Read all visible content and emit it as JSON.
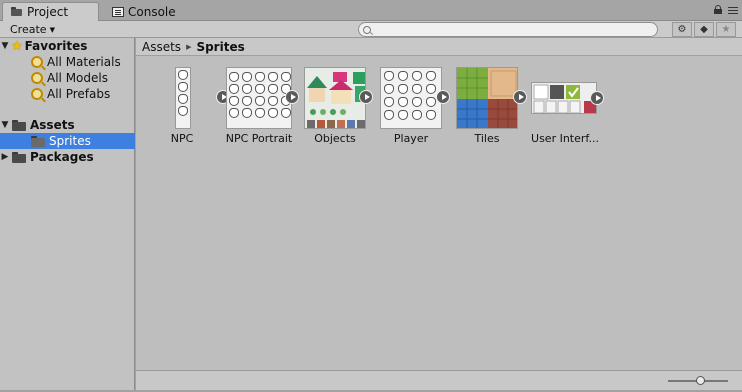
{
  "tabs": [
    {
      "label": "Project",
      "icon": "folder-icon"
    },
    {
      "label": "Console",
      "icon": "console-icon"
    }
  ],
  "toolbar": {
    "create_label": "Create",
    "search_placeholder": ""
  },
  "tree": {
    "favorites": {
      "label": "Favorites",
      "items": [
        "All Materials",
        "All Models",
        "All Prefabs"
      ]
    },
    "assets": {
      "label": "Assets",
      "children": [
        "Sprites"
      ]
    },
    "packages": {
      "label": "Packages"
    }
  },
  "breadcrumb": {
    "root": "Assets",
    "current": "Sprites"
  },
  "assets": [
    {
      "label": "NPC"
    },
    {
      "label": "NPC Portrait"
    },
    {
      "label": "Objects"
    },
    {
      "label": "Player"
    },
    {
      "label": "Tiles"
    },
    {
      "label": "User Interf..."
    }
  ],
  "zoom": 0.5,
  "colors": {
    "selection": "#3d80df",
    "panel": "#c2c2c2"
  }
}
